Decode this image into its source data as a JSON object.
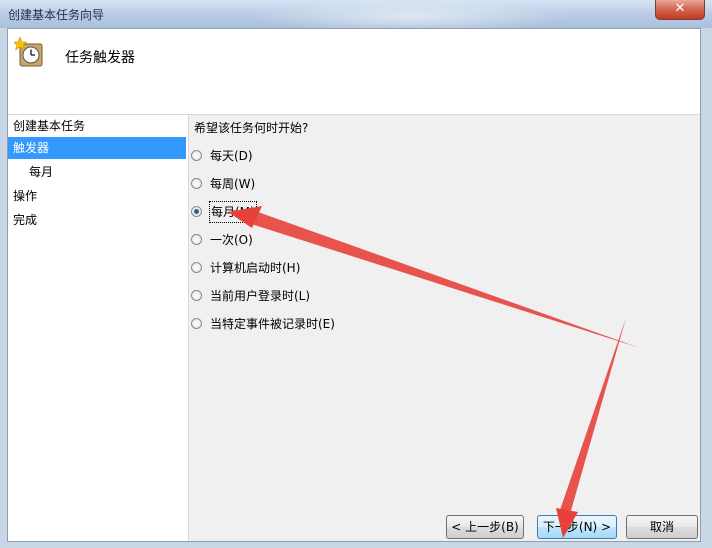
{
  "window": {
    "title": "创建基本任务向导",
    "close_label": "✕"
  },
  "header": {
    "title": "任务触发器",
    "icon": "task-clock-icon"
  },
  "sidebar": {
    "steps": [
      {
        "label": "创建基本任务"
      },
      {
        "label": "触发器",
        "active": true
      },
      {
        "label": "每月",
        "sub": true
      },
      {
        "label": "操作"
      },
      {
        "label": "完成"
      }
    ]
  },
  "main": {
    "question": "希望该任务何时开始?",
    "options": [
      {
        "label": "每天(D)",
        "checked": false
      },
      {
        "label": "每周(W)",
        "checked": false
      },
      {
        "label": "每月(M)",
        "checked": true
      },
      {
        "label": "一次(O)",
        "checked": false
      },
      {
        "label": "计算机启动时(H)",
        "checked": false
      },
      {
        "label": "当前用户登录时(L)",
        "checked": false
      },
      {
        "label": "当特定事件被记录时(E)",
        "checked": false
      }
    ]
  },
  "buttons": {
    "back": "< 上一步(B)",
    "next": "下一步(N) >",
    "cancel": "取消"
  },
  "annotation_color": "#e8413c"
}
